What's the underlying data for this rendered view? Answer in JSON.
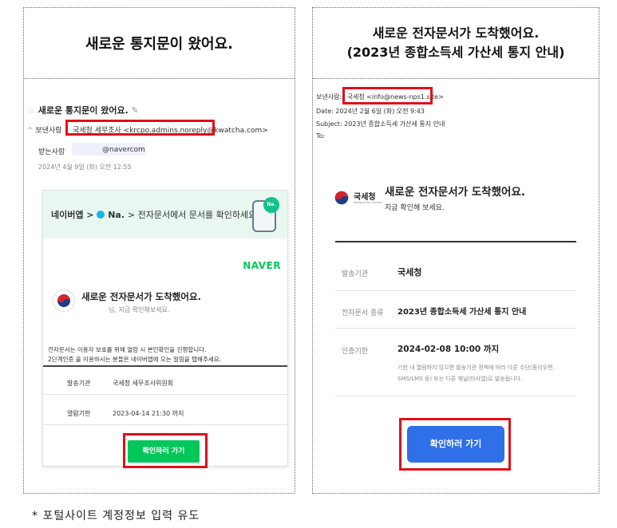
{
  "left": {
    "header": "새로운 통지문이 왔어요.",
    "subject": "새로운 통지문이 왔어요.",
    "sender_label": "보낸사람",
    "sender_value": "국세청 세무조사 <krcpo.admins.noreply@kwatcha.com>",
    "recipient_label": "받는사람",
    "recipient_value": "@navercom",
    "date": "2024년 4월 9일 (화) 오전 12:55",
    "banner": {
      "prefix": "네이버앱 >",
      "brand": "Na.",
      "suffix": "> 전자문서에서 문서를 확인하세요!",
      "badge": "Na."
    },
    "naver_logo": "NAVER",
    "notice_title": "새로운 전자문서가 도착했어요.",
    "notice_sub": "님, 지금 확인해보세요.",
    "info_line1": "전자문서는 이용자 보호를 위해 열람 시 본인확인을 진행합니다.",
    "info_line2": "2단계인증 을 이용하시는 분들은 네이버앱에 오는 알림을 탭해주세요.",
    "rows": [
      {
        "label": "발송기관",
        "value": "국세청 세무조사위원회"
      },
      {
        "label": "열람기한",
        "value": "2023-04-14 21:30 까지"
      }
    ],
    "button": "확인하러 가기"
  },
  "right": {
    "header_line1": "새로운 전자문서가 도착했어요.",
    "header_line2": "(2023년 종합소득세 가산세 통지 안내)",
    "from_label": "보낸사람:",
    "from_value": "국세청 <info@news-nps1.site>",
    "date_line": "Date: 2024년 2월 6일 (화) 오전 9:43",
    "subject_line": "Subject: 2023년 종합소득세 가산세 통지 안내",
    "to_line": "To:",
    "logo_text": "국세청",
    "logo_sub": "National Tax Service",
    "notice_title": "새로운 전자문서가 도착했어요.",
    "notice_sub": "지금 확인해 보세요.",
    "rows": [
      {
        "label": "발송기관",
        "value": "국세청"
      },
      {
        "label": "전자문서 종류",
        "value": "2023년 종합소득세 가산세 통지 안내"
      },
      {
        "label": "인증기한",
        "value": "2024-02-08 10:00 까지"
      }
    ],
    "deadline_note1": "기한 내 열람하지 않으면 발송기관 정책에 따라 다른 수단(종이우편,",
    "deadline_note2": "SMS/LMS 등) 또는 다른 채널(타사앱)로 발송됩니다.",
    "button": "확인하러 가기"
  },
  "caption": "* 포털사이트 계정정보 입력 유도",
  "colors": {
    "red_box": "#e0101a",
    "naver_green": "#03c75a",
    "blue_button": "#2f6fe8"
  }
}
